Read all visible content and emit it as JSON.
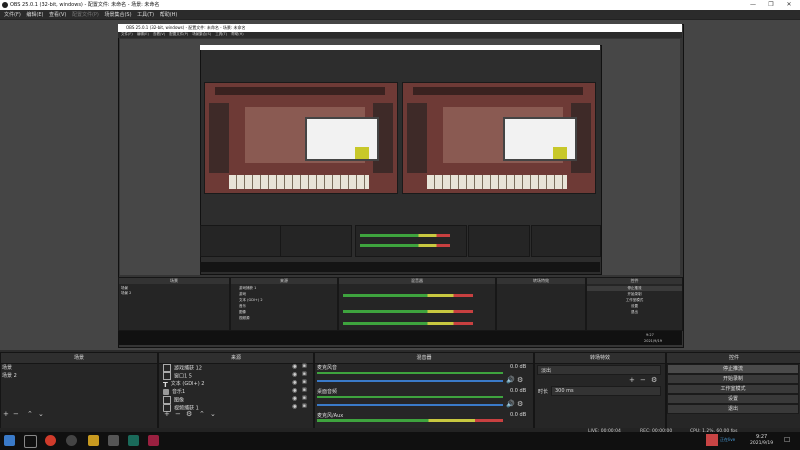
{
  "window": {
    "title": "OBS 25.0.1 (32-bit, windows) - 配置文件: 未命名 - 场景: 未命名",
    "minimize": "—",
    "maximize": "❐",
    "close": "✕"
  },
  "menu": [
    "文件(F)",
    "编辑(E)",
    "查看(V)",
    "配置文件(P)",
    "场景集合(S)",
    "工具(T)",
    "帮助(H)"
  ],
  "nested": {
    "title": "OBS 25.0.1 (32-bit, windows) - 配置文件: 未命名 - 场景: 未命名",
    "menu": [
      "文件(F)",
      "编辑(E)",
      "查看(V)",
      "配置文件(P)",
      "场景集合(S)",
      "工具(T)",
      "帮助(H)"
    ],
    "docks": [
      "场景",
      "来源",
      "混音器",
      "转场特效",
      "控件"
    ],
    "scenes": [
      "场景",
      "场景 2"
    ],
    "sources": [
      "游戏捕获 1",
      "游戏",
      "文本 (GDI+) 2",
      "音乐",
      "图像",
      "视频源"
    ],
    "time": "9:27",
    "date": "2021/9/19",
    "controls": [
      "停止推流",
      "开始录制",
      "工作室模式",
      "设置",
      "退出"
    ]
  },
  "scenes_dock": {
    "header": "场景",
    "items": [
      "场景",
      "场景 2"
    ]
  },
  "sources_dock": {
    "header": "来源",
    "items": [
      {
        "icon": "game-capture-icon",
        "label": "游戏捕获 12"
      },
      {
        "icon": "window-icon",
        "label": "窗口1 5"
      },
      {
        "icon": "text-icon",
        "label": "文本 (GDI+) 2"
      },
      {
        "icon": "audio-icon",
        "label": "音乐1"
      },
      {
        "icon": "image-icon",
        "label": "图像"
      },
      {
        "icon": "camera-icon",
        "label": "视频捕获 1"
      }
    ]
  },
  "mixer": {
    "header": "混音器",
    "channels": [
      {
        "name": "麦克风音",
        "db": "0.0 dB",
        "level": 0.75
      },
      {
        "name": "桌面音频",
        "db": "0.0 dB",
        "level": 0.75
      },
      {
        "name": "麦克风/Aux",
        "db": "0.0 dB",
        "level": 0.6
      }
    ]
  },
  "transitions": {
    "header": "转场特效",
    "type": "淡出",
    "duration_label": "时长",
    "duration": "300 ms"
  },
  "controls": {
    "header": "控件",
    "buttons": [
      "停止推流",
      "开始录制",
      "工作室模式",
      "设置",
      "退出"
    ]
  },
  "status": {
    "live": "LIVE: 00:00:04",
    "rec": "REC: 00:00:00",
    "cpu": "CPU: 1.2%, 60.00 fps"
  },
  "taskbar": {
    "time": "9:27",
    "date": "2021/9/19",
    "notify": "正在live"
  },
  "colors": {
    "accent": "#3a7ac8",
    "meter_green": "#3ea33e",
    "meter_yellow": "#c8c840",
    "meter_red": "#c84040"
  }
}
